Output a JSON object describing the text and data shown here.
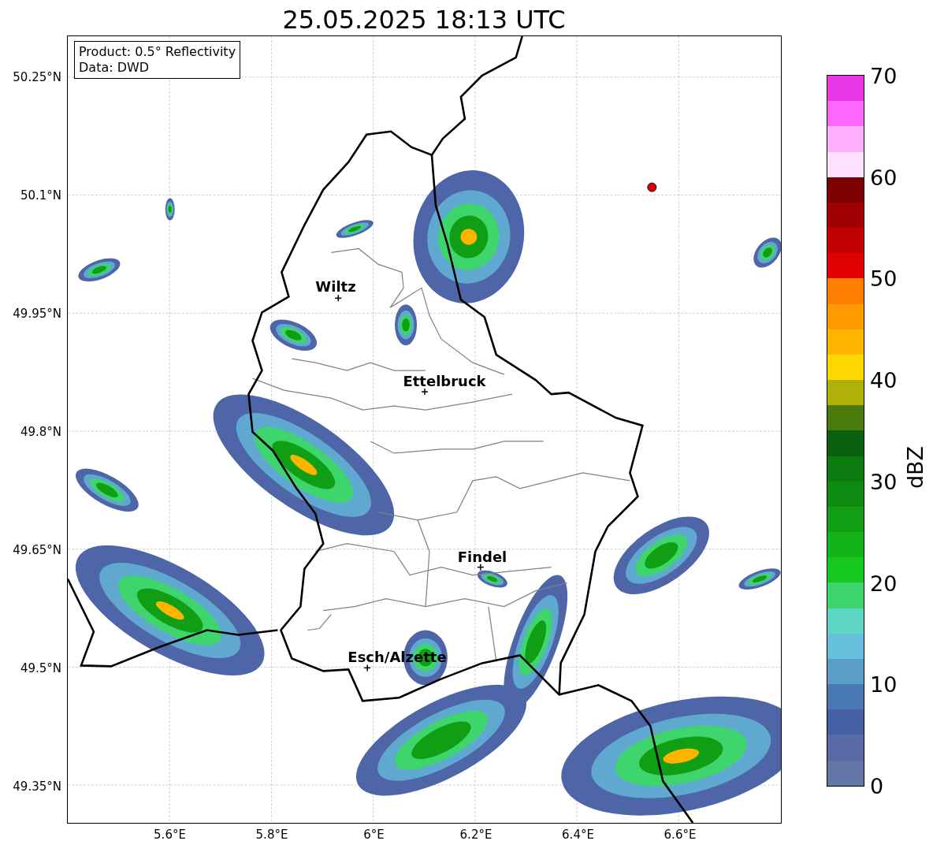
{
  "title": "25.05.2025 18:13 UTC",
  "info_box": {
    "lines": [
      "Product: 0.5° Reflectivity",
      "Data: DWD"
    ]
  },
  "map": {
    "lat_ticks": [
      "50.25°N",
      "50.1°N",
      "49.95°N",
      "49.8°N",
      "49.65°N",
      "49.5°N",
      "49.35°N"
    ],
    "lon_ticks": [
      "5.6°E",
      "5.8°E",
      "6°E",
      "6.2°E",
      "6.4°E",
      "6.6°E"
    ],
    "cities": [
      {
        "name": "Wiltz"
      },
      {
        "name": "Ettelbruck"
      },
      {
        "name": "Findel"
      },
      {
        "name": "Esch/Alzette"
      }
    ]
  },
  "colorbar": {
    "label": "dBZ",
    "ticks": [
      "70",
      "60",
      "50",
      "40",
      "30",
      "20",
      "10",
      "0"
    ],
    "segments": [
      {
        "color": "#6475a8"
      },
      {
        "color": "#5a6aa6"
      },
      {
        "color": "#4660a6"
      },
      {
        "color": "#4a78b2"
      },
      {
        "color": "#5b9ec8"
      },
      {
        "color": "#66c0dc"
      },
      {
        "color": "#5dd6c4"
      },
      {
        "color": "#3ed66c"
      },
      {
        "color": "#14c81e"
      },
      {
        "color": "#12b41a"
      },
      {
        "color": "#109e14"
      },
      {
        "color": "#0e8c12"
      },
      {
        "color": "#0b7a0f"
      },
      {
        "color": "#086010"
      },
      {
        "color": "#4a7a0c"
      },
      {
        "color": "#b0b00a"
      },
      {
        "color": "#ffd700"
      },
      {
        "color": "#ffb400"
      },
      {
        "color": "#ff9a00"
      },
      {
        "color": "#ff7f00"
      },
      {
        "color": "#e00000"
      },
      {
        "color": "#c00000"
      },
      {
        "color": "#a00000"
      },
      {
        "color": "#7d0000"
      },
      {
        "color": "#ffe0ff"
      },
      {
        "color": "#ffb0ff"
      },
      {
        "color": "#ff66ff"
      },
      {
        "color": "#e838e8"
      }
    ]
  }
}
